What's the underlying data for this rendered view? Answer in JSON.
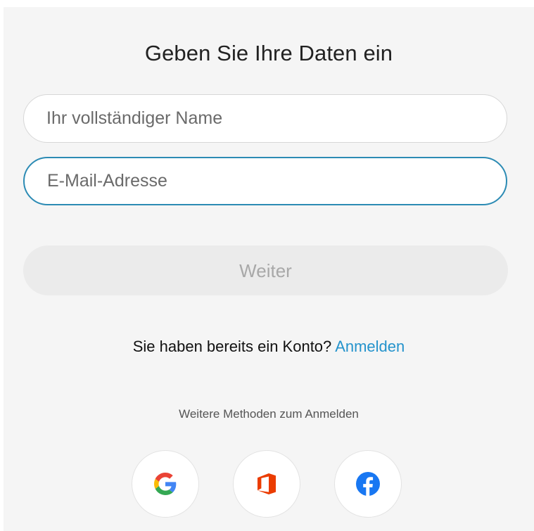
{
  "form": {
    "title": "Geben Sie Ihre Daten ein",
    "name_placeholder": "Ihr vollständiger Name",
    "name_value": "",
    "email_placeholder": "E-Mail-Adresse",
    "email_value": "",
    "continue_label": "Weiter"
  },
  "account": {
    "prompt": "Sie haben bereits ein Konto?",
    "login_link": "Anmelden"
  },
  "other_methods": {
    "label": "Weitere Methoden zum Anmelden",
    "providers": [
      {
        "icon": "google-icon"
      },
      {
        "icon": "office-icon"
      },
      {
        "icon": "facebook-icon"
      }
    ]
  },
  "colors": {
    "panel_bg": "#f5f5f5",
    "focus_border": "#2c8bb4",
    "link": "#2493cc",
    "disabled_button_bg": "#ebebeb",
    "disabled_button_text": "#a8a8a8",
    "office": "#eb3c00",
    "facebook": "#1877f2"
  }
}
